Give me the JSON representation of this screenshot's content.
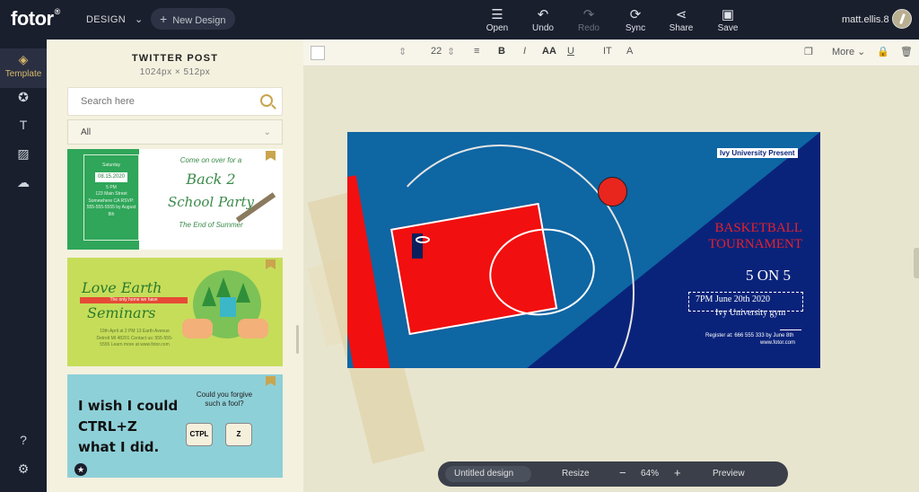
{
  "header": {
    "logo": "fotor",
    "logo_mark": "®",
    "design_menu": "DESIGN",
    "new_design": "New Design",
    "tools": [
      {
        "label": "Open",
        "icon": "open-icon"
      },
      {
        "label": "Undo",
        "icon": "undo-icon"
      },
      {
        "label": "Redo",
        "icon": "redo-icon"
      },
      {
        "label": "Sync",
        "icon": "sync-icon"
      },
      {
        "label": "Share",
        "icon": "share-icon"
      },
      {
        "label": "Save",
        "icon": "save-icon"
      }
    ],
    "user": "matt.ellis.8"
  },
  "rail": {
    "template_label": "Template"
  },
  "panel": {
    "title": "TWITTER POST",
    "subtitle": "1024px × 512px",
    "search_placeholder": "Search here",
    "filter": "All",
    "cards": {
      "c1": {
        "come": "Come on over for a",
        "back": "Back 2",
        "party": "School Party",
        "end": "The End of Summer",
        "left_top": "Saturday",
        "date": "08.15.2020",
        "time": "5 PM",
        "info": "123 Main Street Somewhere CA RSVP: 555-555-5555 by August 8th"
      },
      "c2": {
        "title1": "Love Earth",
        "band": "The only home we have",
        "title2": "Seminars",
        "details": "19th April at 2 PM 13 Earth Avenue Detroit MI 48201 Contact us: 555-555-5555 Learn more at www.fotor.com"
      },
      "c3": {
        "line1": "I wish I could",
        "line2": "CTRL+Z",
        "line3": "what I did.",
        "question": "Could you forgive such a fool?",
        "key1": "CTPL",
        "key2": "Z"
      }
    }
  },
  "toolbar": {
    "font_size": "22",
    "more": "More"
  },
  "design": {
    "presenter": "Ivy University Present",
    "title": "BASKETBALL TOURNAMENT",
    "format": "5 ON 5",
    "when": "7PM June 20th 2020",
    "where": "Ivy University gym",
    "register": "Register at: 666 555 333 by June 8th",
    "website": "www.fotor.com"
  },
  "bottom": {
    "name": "Untitled design",
    "resize": "Resize",
    "zoom": "64%",
    "preview": "Preview"
  }
}
